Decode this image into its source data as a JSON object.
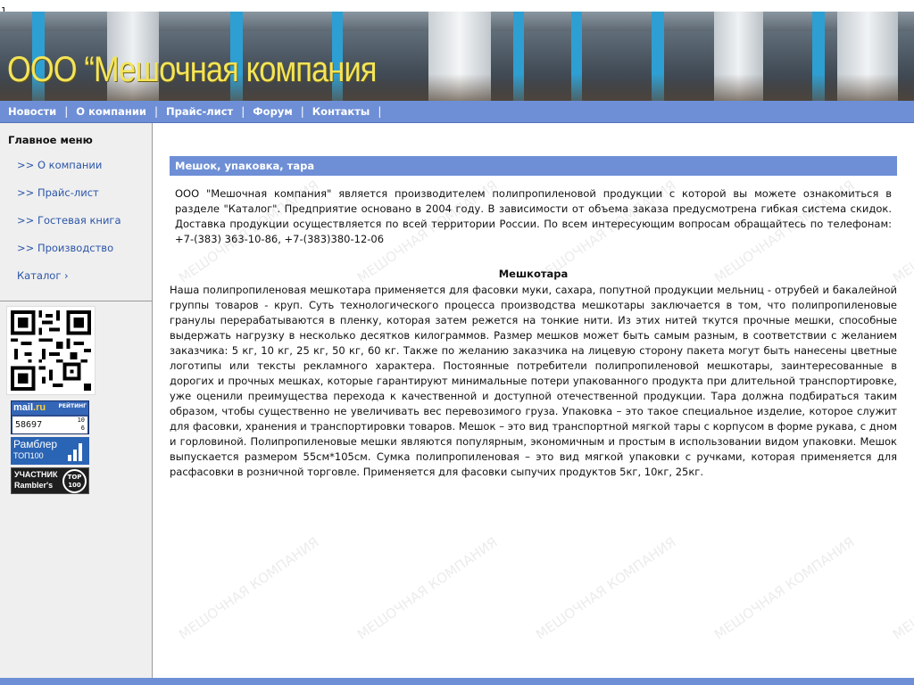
{
  "page_marker": "1",
  "header": {
    "site_title": "ООО “Мешочная компания"
  },
  "nav": {
    "items": [
      "Новости",
      "О компании",
      "Прайс-лист",
      "Форум",
      "Контакты"
    ],
    "separator": "|"
  },
  "sidebar": {
    "menu_title": "Главное меню",
    "items": [
      {
        "arrow": ">>",
        "label": "О компании"
      },
      {
        "arrow": ">>",
        "label": "Прайс-лист"
      },
      {
        "arrow": ">>",
        "label": "Гостевая книга"
      },
      {
        "arrow": ">>",
        "label": "Производство"
      },
      {
        "arrow": "›",
        "label": "Каталог"
      }
    ],
    "badges": {
      "mail_logo": "mail",
      "mail_logo_suffix": ".ru",
      "mail_rating_label": "РЕЙТИНГ",
      "mail_counter": "58697",
      "mail_small_top": "10",
      "mail_small_bottom": "6",
      "rambler_line1": "Рамблер",
      "rambler_line2": "ТОП100",
      "uchastnik_line1": "УЧАСТНИК",
      "uchastnik_line2": "Rambler's",
      "uchastnik_circle": "TOP 100"
    }
  },
  "content": {
    "section_title": "Мешок, упаковка, тара",
    "intro": "ООО \"Мешочная компания\" является производителем полипропиленовой продукции с которой вы можете ознакомиться в разделе \"Каталог\". Предприятие основано в 2004 году. В зависимости от объема заказа предусмотрена гибкая система скидок. Доставка продукции осуществляется по всей территории России. По всем интересующим вопросам обращайтесь по телефонам: +7-(383) 363-10-86, +7-(383)380-12-06",
    "subtitle": "Мешкотара",
    "body": "Наша полипропиленовая мешкотара применяется для фасовки муки, сахара, попутной продукции мельниц - отрубей и бакалейной группы товаров - круп. Суть технологического процесса производства мешкотары заключается в том, что  полипропиленовые гранулы перерабатываются в пленку, которая затем режется на тонкие нити. Из этих нитей ткутся прочные мешки, способные выдержать нагрузку в несколько десятков килограммов. Размер мешков может быть самым разным, в соответствии с желанием заказчика: 5 кг, 10 кг, 25 кг, 50 кг, 60 кг. Также по желанию заказчика на лицевую сторону пакета могут быть нанесены цветные логотипы или тексты рекламного характера. Постоянные потребители полипропиленовой мешкотары, заинтересованные в дорогих и прочных мешках, которые гарантируют минимальные потери упакованного продукта при длительной транспортировке, уже оценили преимущества перехода к качественной и доступной отечественной продукции. Тара должна подбираться таким образом, чтобы существенно не увеличивать вес перевозимого груза. Упаковка – это такое специальное изделие, которое служит для фасовки, хранения и транспортировки товаров. Мешок – это вид транспортной мягкой тары с корпусом в форме рукава, с дном и горловиной. Полипропиленовые мешки являются популярным, экономичным и простым в использовании видом упаковки. Мешок выпускается размером 55см*105см. Сумка полипропиленовая – это вид мягкой упаковки с ручками, которая применяется для расфасовки в розничной торговле. Применяется для фасовки сыпучих продуктов 5кг, 10кг, 25кг.",
    "watermark_text": "МЕШОЧНАЯ КОМПАНИЯ"
  },
  "colors": {
    "nav_bar": "#6e8fd6",
    "title_yellow": "#f3e45a",
    "sidebar_bg": "#efefef",
    "link_blue": "#2b55a8"
  }
}
